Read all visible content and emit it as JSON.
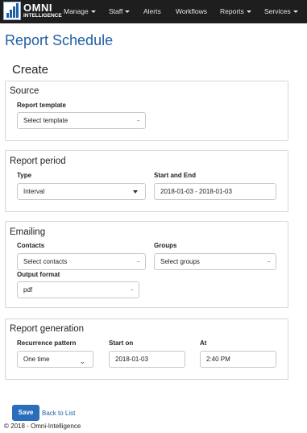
{
  "navbar": {
    "brand_line1": "OMNI",
    "brand_line2": "INTELLIGENCE",
    "items": [
      {
        "label": "Manage",
        "dropdown": true
      },
      {
        "label": "Staff",
        "dropdown": true
      },
      {
        "label": "Alerts",
        "dropdown": false
      },
      {
        "label": "Workflows",
        "dropdown": false
      },
      {
        "label": "Reports",
        "dropdown": true
      },
      {
        "label": "Services",
        "dropdown": true
      }
    ]
  },
  "page_title": "Report Schedule",
  "create_title": "Create",
  "source": {
    "title": "Source",
    "report_template_label": "Report template",
    "report_template_value": "Select template"
  },
  "report_period": {
    "title": "Report period",
    "type_label": "Type",
    "type_value": "Interval",
    "start_end_label": "Start and End",
    "start_end_value": "2018-01-03 - 2018-01-03"
  },
  "emailing": {
    "title": "Emailing",
    "contacts_label": "Contacts",
    "contacts_value": "Select contacts",
    "groups_label": "Groups",
    "groups_value": "Select groups",
    "output_format_label": "Output format",
    "output_format_value": "pdf"
  },
  "report_generation": {
    "title": "Report generation",
    "recurrence_label": "Recurrence pattern",
    "recurrence_value": "One time",
    "start_on_label": "Start on",
    "start_on_value": "2018-01-03",
    "at_label": "At",
    "at_value": "2:40 PM"
  },
  "actions": {
    "save_label": "Save",
    "back_label": "Back to List"
  },
  "footer": "© 2018 - Omni-Intelligence",
  "colors": {
    "navbar_bg": "#1e1e1e",
    "accent": "#1f5fa5",
    "save_button": "#2a6ebb"
  }
}
